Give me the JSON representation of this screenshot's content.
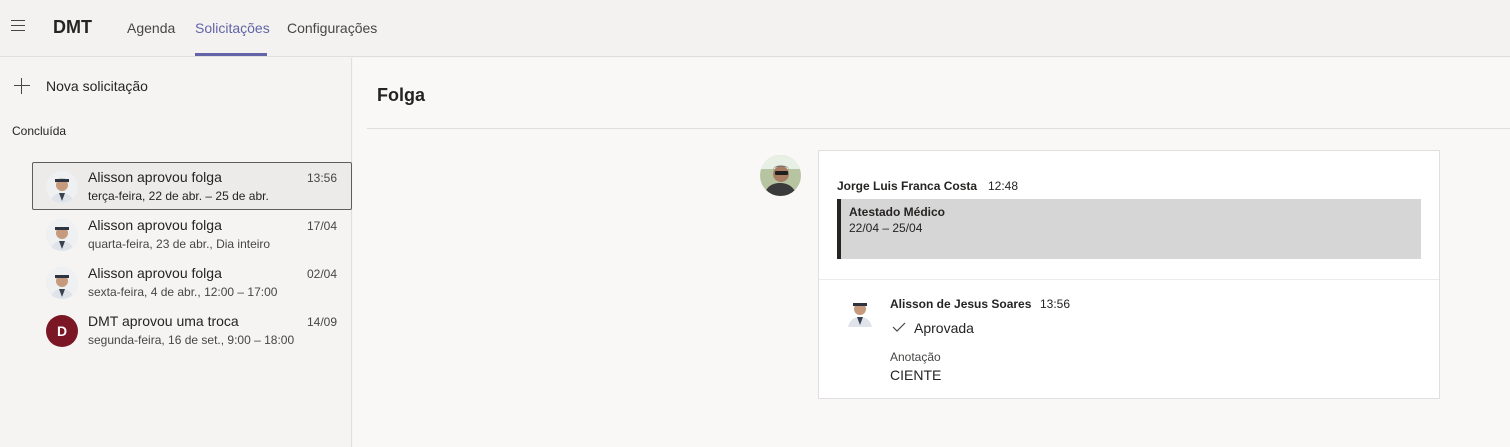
{
  "app": {
    "title": "DMT"
  },
  "tabs": [
    {
      "label": "Agenda"
    },
    {
      "label": "Solicitações"
    },
    {
      "label": "Configurações"
    }
  ],
  "sidebar": {
    "new_request_label": "Nova solicitação",
    "section_label": "Concluída",
    "items": [
      {
        "title": "Alisson aprovou folga",
        "subtitle": "terça-feira, 22 de abr. – 25 de abr.",
        "time": "13:56"
      },
      {
        "title": "Alisson aprovou folga",
        "subtitle": "quarta-feira, 23 de abr., Dia inteiro",
        "time": "17/04"
      },
      {
        "title": "Alisson aprovou folga",
        "subtitle": "sexta-feira, 4 de abr., 12:00 – 17:00",
        "time": "02/04"
      },
      {
        "title": "DMT aprovou uma troca",
        "subtitle": "segunda-feira, 16 de set., 9:00 – 18:00",
        "time": "14/09",
        "avatar_letter": "D"
      }
    ]
  },
  "detail": {
    "title": "Folga",
    "request": {
      "author": "Jorge Luis Franca Costa",
      "time": "12:48",
      "type": "Atestado Médico",
      "dates": "22/04 – 25/04"
    },
    "response": {
      "author": "Alisson de Jesus Soares",
      "time": "13:56",
      "status": "Aprovada",
      "note_label": "Anotação",
      "note": "CIENTE"
    }
  },
  "colors": {
    "accent": "#6264a7",
    "letter_avatar": "#7b1625"
  }
}
